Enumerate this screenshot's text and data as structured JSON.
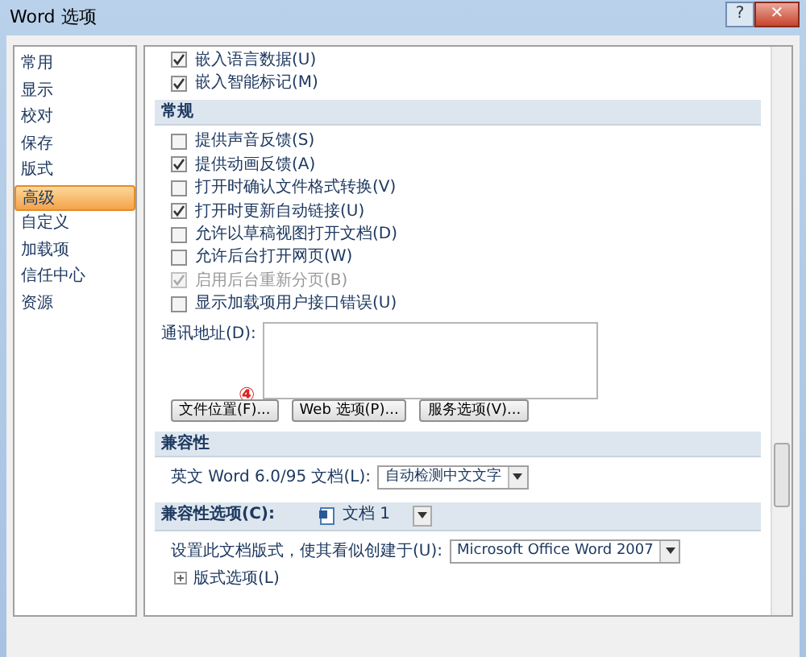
{
  "window": {
    "title": "Word 选项",
    "help": "?",
    "close": "✕"
  },
  "sidebar": {
    "items": [
      {
        "label": "常用",
        "selected": false
      },
      {
        "label": "显示",
        "selected": false
      },
      {
        "label": "校对",
        "selected": false
      },
      {
        "label": "保存",
        "selected": false
      },
      {
        "label": "版式",
        "selected": false
      },
      {
        "label": "高级",
        "selected": true
      },
      {
        "label": "自定义",
        "selected": false
      },
      {
        "label": "加载项",
        "selected": false
      },
      {
        "label": "信任中心",
        "selected": false
      },
      {
        "label": "资源",
        "selected": false
      }
    ]
  },
  "top_options": [
    {
      "label": "嵌入语言数据(U)",
      "checked": true,
      "disabled": false
    },
    {
      "label": "嵌入智能标记(M)",
      "checked": true,
      "disabled": false
    }
  ],
  "general": {
    "heading": "常规",
    "options": [
      {
        "label": "提供声音反馈(S)",
        "checked": false,
        "disabled": false
      },
      {
        "label": "提供动画反馈(A)",
        "checked": true,
        "disabled": false
      },
      {
        "label": "打开时确认文件格式转换(V)",
        "checked": false,
        "disabled": false
      },
      {
        "label": "打开时更新自动链接(U)",
        "checked": true,
        "disabled": false
      },
      {
        "label": "允许以草稿视图打开文档(D)",
        "checked": false,
        "disabled": false
      },
      {
        "label": "允许后台打开网页(W)",
        "checked": false,
        "disabled": false
      },
      {
        "label": "启用后台重新分页(B)",
        "checked": true,
        "disabled": true
      },
      {
        "label": "显示加载项用户接口错误(U)",
        "checked": false,
        "disabled": false
      }
    ],
    "address_label": "通讯地址(D):",
    "annotation": "④",
    "buttons": [
      "文件位置(F)...",
      "Web 选项(P)...",
      "服务选项(V)..."
    ]
  },
  "compatibility": {
    "heading": "兼容性",
    "label": "英文 Word 6.0/95 文档(L):",
    "value": "自动检测中文文字"
  },
  "compat_options": {
    "label": "兼容性选项(C):",
    "document": "文档 1",
    "layout_label": "设置此文档版式，使其看似创建于(U):",
    "layout_value": "Microsoft Office Word 2007",
    "expander": "版式选项(L)",
    "expanded": false
  }
}
